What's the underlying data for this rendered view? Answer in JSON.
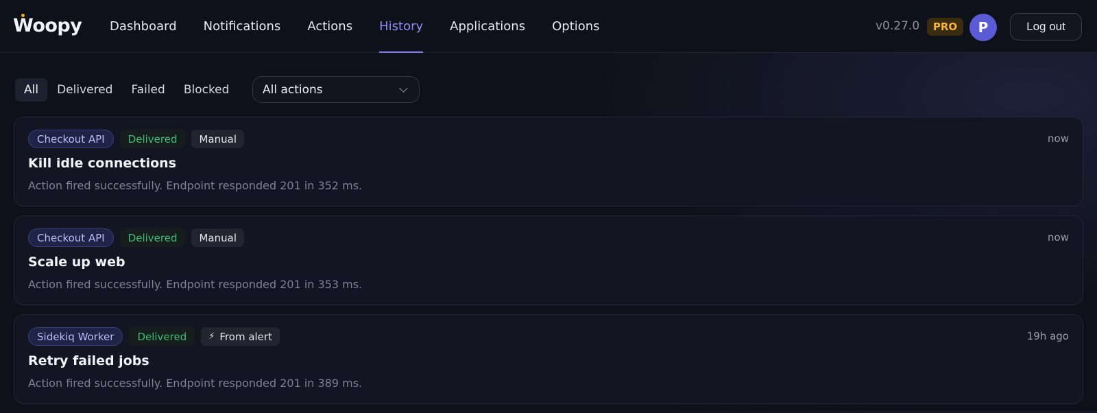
{
  "app": {
    "logo": "Woopy",
    "version": "v0.27.0",
    "plan_badge": "PRO",
    "avatar_initial": "P",
    "logout_label": "Log out"
  },
  "nav": {
    "items": [
      {
        "label": "Dashboard"
      },
      {
        "label": "Notifications"
      },
      {
        "label": "Actions"
      },
      {
        "label": "History"
      },
      {
        "label": "Applications"
      },
      {
        "label": "Options"
      }
    ],
    "active": "History"
  },
  "filters": {
    "tabs": [
      {
        "label": "All"
      },
      {
        "label": "Delivered"
      },
      {
        "label": "Failed"
      },
      {
        "label": "Blocked"
      }
    ],
    "active": "All",
    "action_select": {
      "value": "All actions"
    }
  },
  "history": [
    {
      "app": "Checkout API",
      "status": "Delivered",
      "source": "Manual",
      "source_icon": "",
      "title": "Kill idle connections",
      "message": "Action fired successfully. Endpoint responded 201 in 352 ms.",
      "time": "now"
    },
    {
      "app": "Checkout API",
      "status": "Delivered",
      "source": "Manual",
      "source_icon": "",
      "title": "Scale up web",
      "message": "Action fired successfully. Endpoint responded 201 in 353 ms.",
      "time": "now"
    },
    {
      "app": "Sidekiq Worker",
      "status": "Delivered",
      "source": "From alert",
      "source_icon": "bolt-icon",
      "title": "Retry failed jobs",
      "message": "Action fired successfully. Endpoint responded 201 in 389 ms.",
      "time": "19h ago"
    }
  ],
  "colors": {
    "background": "#0f111a",
    "accent": "#7c7ff2",
    "delivered": "#3fbf78",
    "pro": "#f5b33b",
    "avatar": "#5b5bd6"
  }
}
